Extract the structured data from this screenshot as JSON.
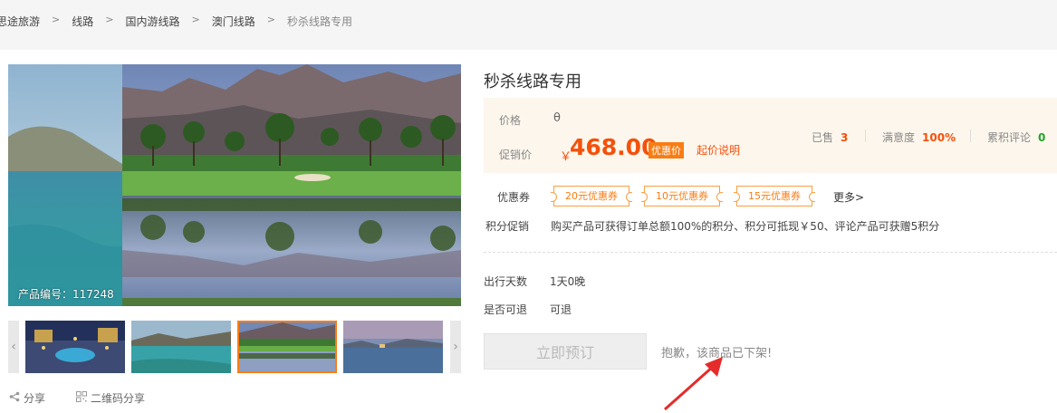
{
  "breadcrumb": [
    "思途旅游",
    "线路",
    "国内游线路",
    "澳门线路",
    "秒杀线路专用"
  ],
  "gallery": {
    "product_no_label": "产品编号：117248",
    "thumb_count": 4,
    "active_thumb": 3
  },
  "share": {
    "share_label": "分享",
    "qr_label": "二维码分享"
  },
  "product": {
    "title": "秒杀线路专用",
    "price_label": "价格",
    "price_value": "θ",
    "promo_label": "促销价",
    "currency": "￥",
    "promo_price": "468.00",
    "promo_tag": "优惠价",
    "starting_note": "起价说明",
    "sold_label": "已售",
    "sold_value": "3",
    "satisfaction_label": "满意度",
    "satisfaction_value": "100%",
    "reviews_label": "累积评论",
    "reviews_value": "0"
  },
  "coupons": {
    "label": "优惠券",
    "items": [
      "20元优惠券",
      "10元优惠券",
      "15元优惠券"
    ],
    "more": "更多>"
  },
  "points": {
    "label": "积分促销",
    "text": "购买产品可获得订单总额100%的积分、积分可抵现￥50、评论产品可获赠5积分"
  },
  "details": [
    {
      "label": "出行天数",
      "value": "1天0晚"
    },
    {
      "label": "是否可退",
      "value": "可退"
    }
  ],
  "actions": {
    "book_label": "立即预订",
    "offshelf_msg": "抱歉，该商品已下架!"
  },
  "colors": {
    "accent": "#f4510b",
    "tag": "#f97d13",
    "green": "#22a42a",
    "annotation": "#e52b2b"
  }
}
